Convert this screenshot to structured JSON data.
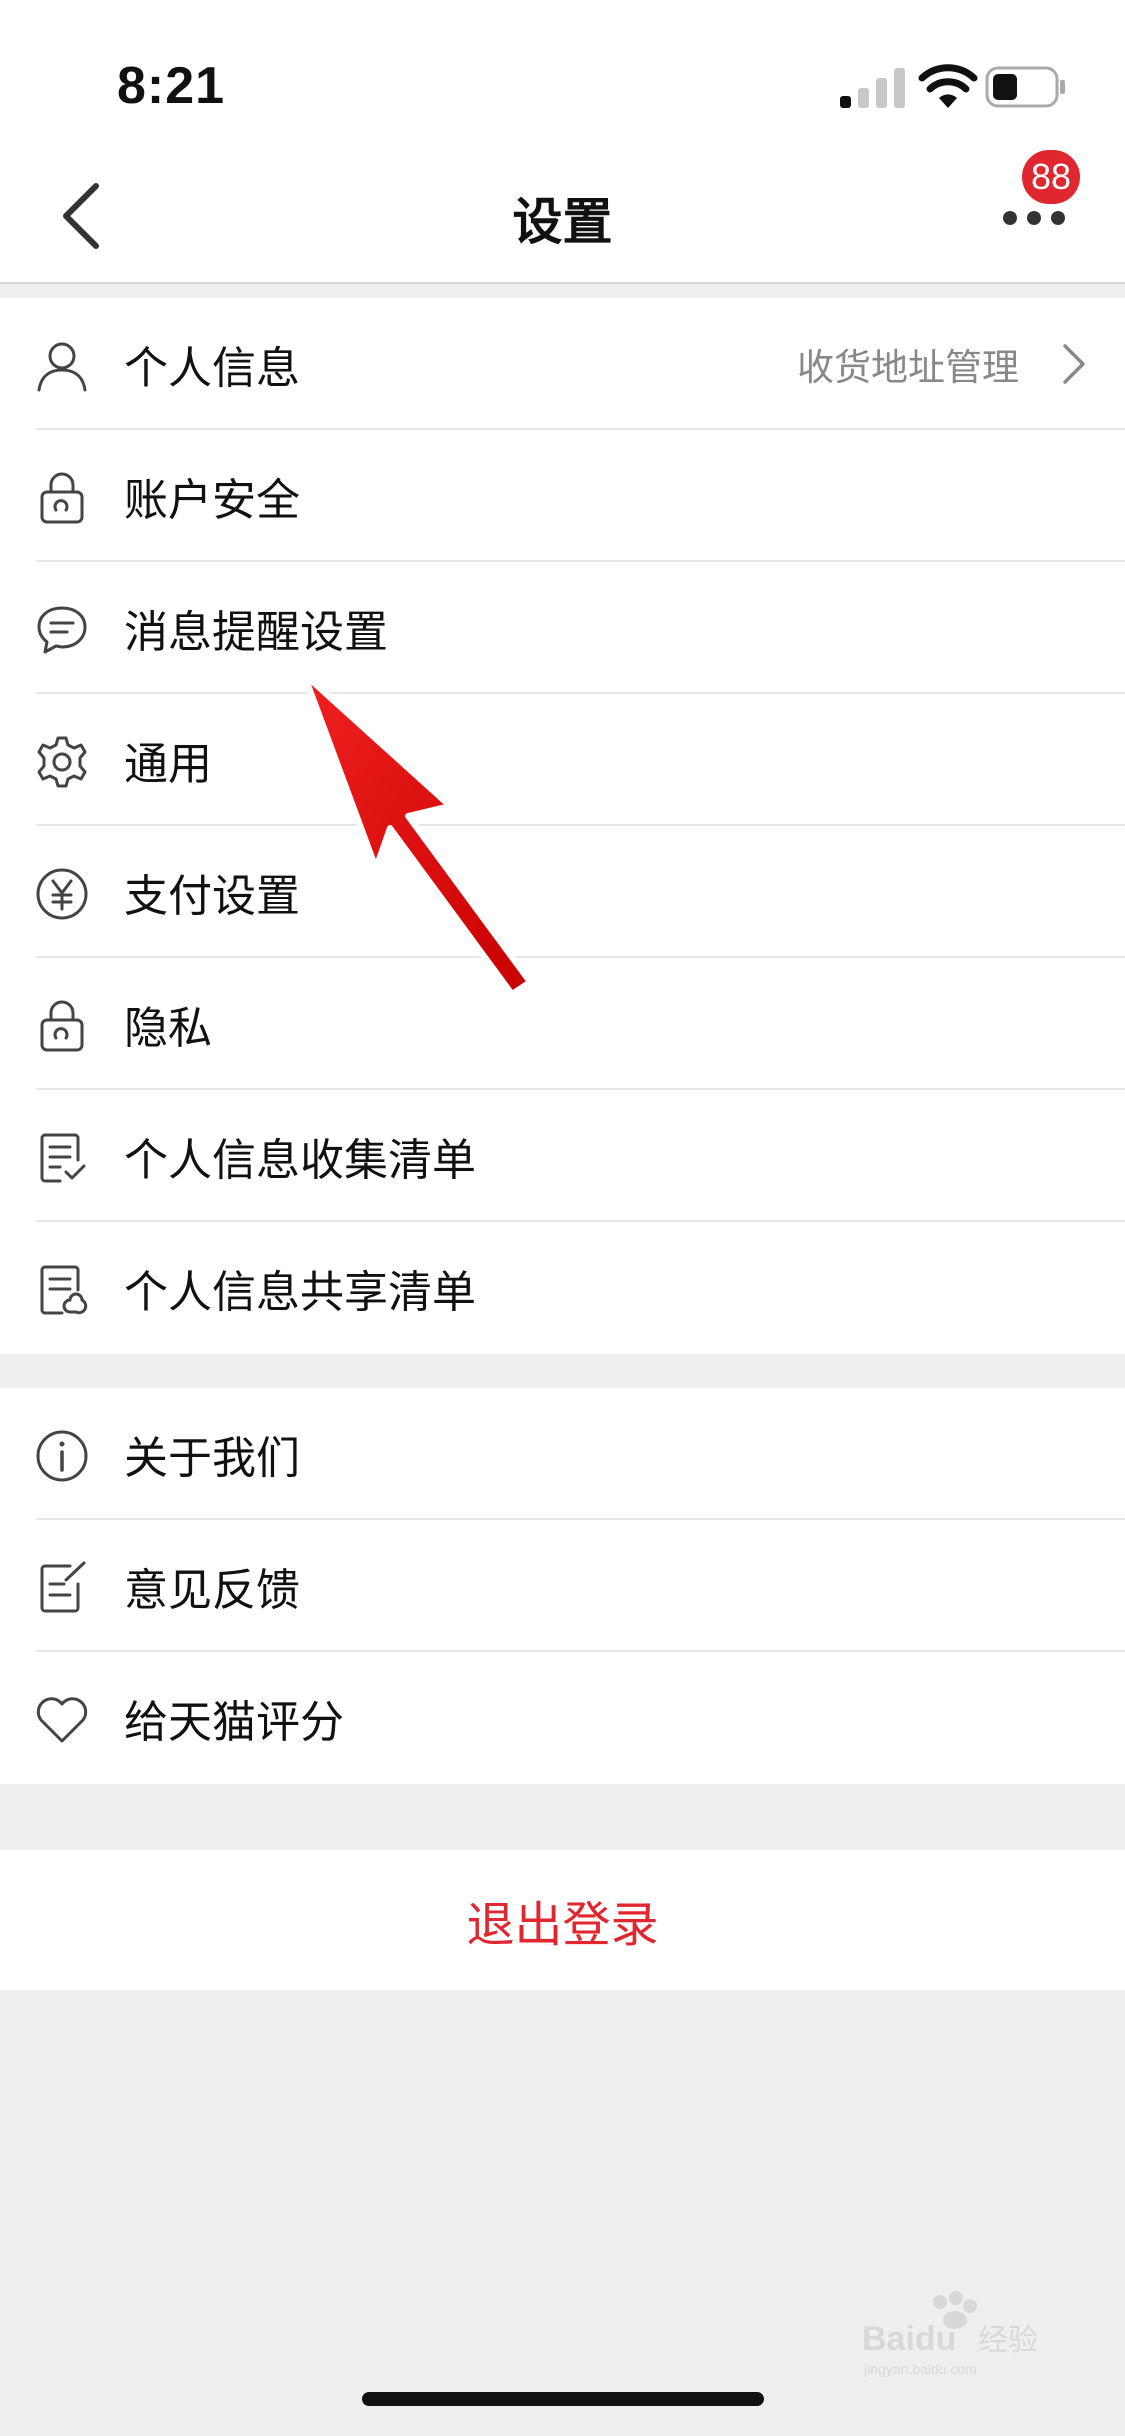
{
  "status_bar": {
    "time": "8:21"
  },
  "nav": {
    "title": "设置",
    "badge_count": "88"
  },
  "groups": [
    {
      "items": [
        {
          "label": "个人信息",
          "extra": "收货地址管理",
          "icon": "person-icon"
        },
        {
          "label": "账户安全",
          "icon": "lock-icon"
        },
        {
          "label": "消息提醒设置",
          "icon": "chat-bubble-icon"
        },
        {
          "label": "通用",
          "icon": "gear-icon"
        },
        {
          "label": "支付设置",
          "icon": "yuan-icon"
        },
        {
          "label": "隐私",
          "icon": "lock-icon"
        },
        {
          "label": "个人信息收集清单",
          "icon": "checklist-icon"
        },
        {
          "label": "个人信息共享清单",
          "icon": "shared-list-icon"
        }
      ]
    },
    {
      "items": [
        {
          "label": "关于我们",
          "icon": "info-icon"
        },
        {
          "label": "意见反馈",
          "icon": "edit-note-icon"
        },
        {
          "label": "给天猫评分",
          "icon": "heart-icon"
        }
      ]
    }
  ],
  "logout": {
    "label": "退出登录"
  },
  "watermark": {
    "line1": "Baidu",
    "line2": "经验",
    "line3": "jingyan.baidu.com"
  },
  "colors": {
    "accent": "#e0262e",
    "background": "#efefef",
    "secondary_text": "#888888"
  }
}
